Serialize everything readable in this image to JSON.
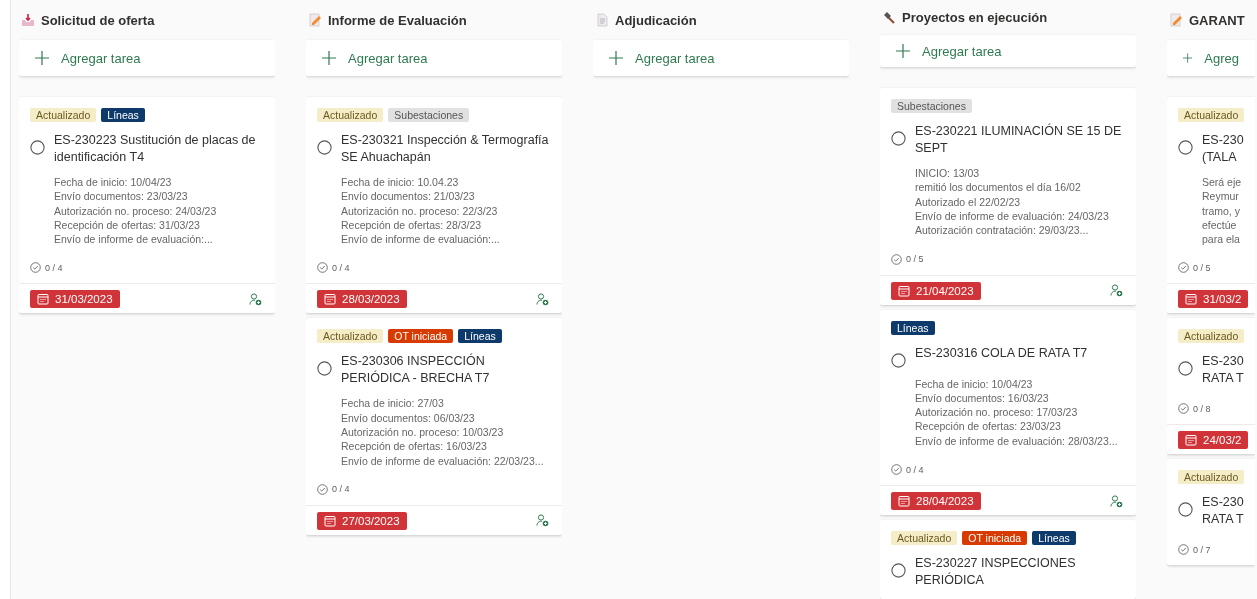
{
  "columns": [
    {
      "title": "Solicitud de oferta",
      "add_label": "Agregar tarea",
      "cards": [
        {
          "tags": [
            {
              "label": "Actualizado",
              "color": "#f5ecc8"
            },
            {
              "label": "Líneas",
              "color": "#0e3a6b"
            }
          ],
          "title": "ES-230223 Sustitución de placas de identificación T4",
          "description": [
            "Fecha de inicio: 10/04/23",
            "Envío documentos: 23/03/23",
            "Autorización no. proceso: 24/03/23",
            "Recepción de ofertas: 31/03/23",
            "Envío de informe de evaluación:..."
          ],
          "checklist": "0 / 4",
          "due": "31/03/2023"
        }
      ]
    },
    {
      "title": "Informe de Evaluación",
      "add_label": "Agregar tarea",
      "cards": [
        {
          "tags": [
            {
              "label": "Actualizado",
              "color": "#f5ecc8"
            },
            {
              "label": "Subestaciones",
              "color": "#e1e1e1"
            }
          ],
          "title": "ES-230321 Inspección & Termografía SE Ahuachapán",
          "description": [
            "Fecha de inicio: 10.04.23",
            "Envío documentos: 21/03/23",
            "Autorización no. proceso: 22/3/23",
            "Recepción de ofertas: 28/3/23",
            "Envío de informe de evaluación:..."
          ],
          "checklist": "0 / 4",
          "due": "28/03/2023"
        },
        {
          "tags": [
            {
              "label": "Actualizado",
              "color": "#f5ecc8"
            },
            {
              "label": "OT iniciada",
              "color": "#d83b01"
            },
            {
              "label": "Líneas",
              "color": "#0e3a6b"
            }
          ],
          "title": "ES-230306 INSPECCIÓN PERIÓDICA - BRECHA T7",
          "description": [
            "Fecha de inicio: 27/03",
            "Envío documentos: 06/03/23",
            "Autorización no. proceso: 10/03/23",
            "Recepción de ofertas: 16/03/23",
            "Envío de informe de evaluación: 22/03/23..."
          ],
          "checklist": "0 / 4",
          "due": "27/03/2023"
        }
      ]
    },
    {
      "title": "Adjudicación",
      "add_label": "Agregar tarea"
    },
    {
      "title": "Proyectos en ejecución",
      "add_label": "Agregar tarea",
      "cards": [
        {
          "tags": [
            {
              "label": "Subestaciones",
              "color": "#e1e1e1"
            }
          ],
          "title": "ES-230221 ILUMINACIÓN SE 15 DE SEPT",
          "description": [
            "INICIO: 13/03",
            "remitió los documentos el día 16/02",
            "Autorizado el 22/02/23",
            "Envío de informe de evaluación: 24/03/23",
            "Autorización contratación: 29/03/23..."
          ],
          "checklist": "0 / 5",
          "due": "21/04/2023"
        },
        {
          "tags": [
            {
              "label": "Líneas",
              "color": "#0e3a6b"
            }
          ],
          "title": "ES-230316 COLA DE RATA T7",
          "description": [
            "Fecha de inicio: 10/04/23",
            "Envío documentos: 16/03/23",
            "Autorización no. proceso: 17/03/23",
            "Recepción de ofertas: 23/03/23",
            "Envío de informe de evaluación: 28/03/23..."
          ],
          "checklist": "0 / 4",
          "due": "28/04/2023"
        },
        {
          "tags": [
            {
              "label": "Actualizado",
              "color": "#f5ecc8"
            },
            {
              "label": "OT iniciada",
              "color": "#d83b01"
            },
            {
              "label": "Líneas",
              "color": "#0e3a6b"
            }
          ],
          "title": "ES-230227 INSPECCIONES PERIÓDICA"
        }
      ]
    },
    {
      "title": "GARANT",
      "add_label": "Agreg",
      "cards": [
        {
          "tags": [
            {
              "label": "Actualizado",
              "color": "#f5ecc8"
            }
          ],
          "title": "ES-230 (TALA",
          "description": [
            "Será eje",
            "Reymur",
            "tramo, y",
            "efectúe",
            "para ela"
          ],
          "checklist": "0 / 5",
          "due": "31/03/2"
        },
        {
          "tags": [
            {
              "label": "Actualizado",
              "color": "#f5ecc8"
            }
          ],
          "title": "ES-230 RATA T",
          "checklist": "0 / 8",
          "due": "24/03/2"
        },
        {
          "tags": [
            {
              "label": "Actualizado",
              "color": "#f5ecc8"
            }
          ],
          "title": "ES-230 RATA T",
          "checklist": "0 / 7"
        }
      ]
    }
  ]
}
